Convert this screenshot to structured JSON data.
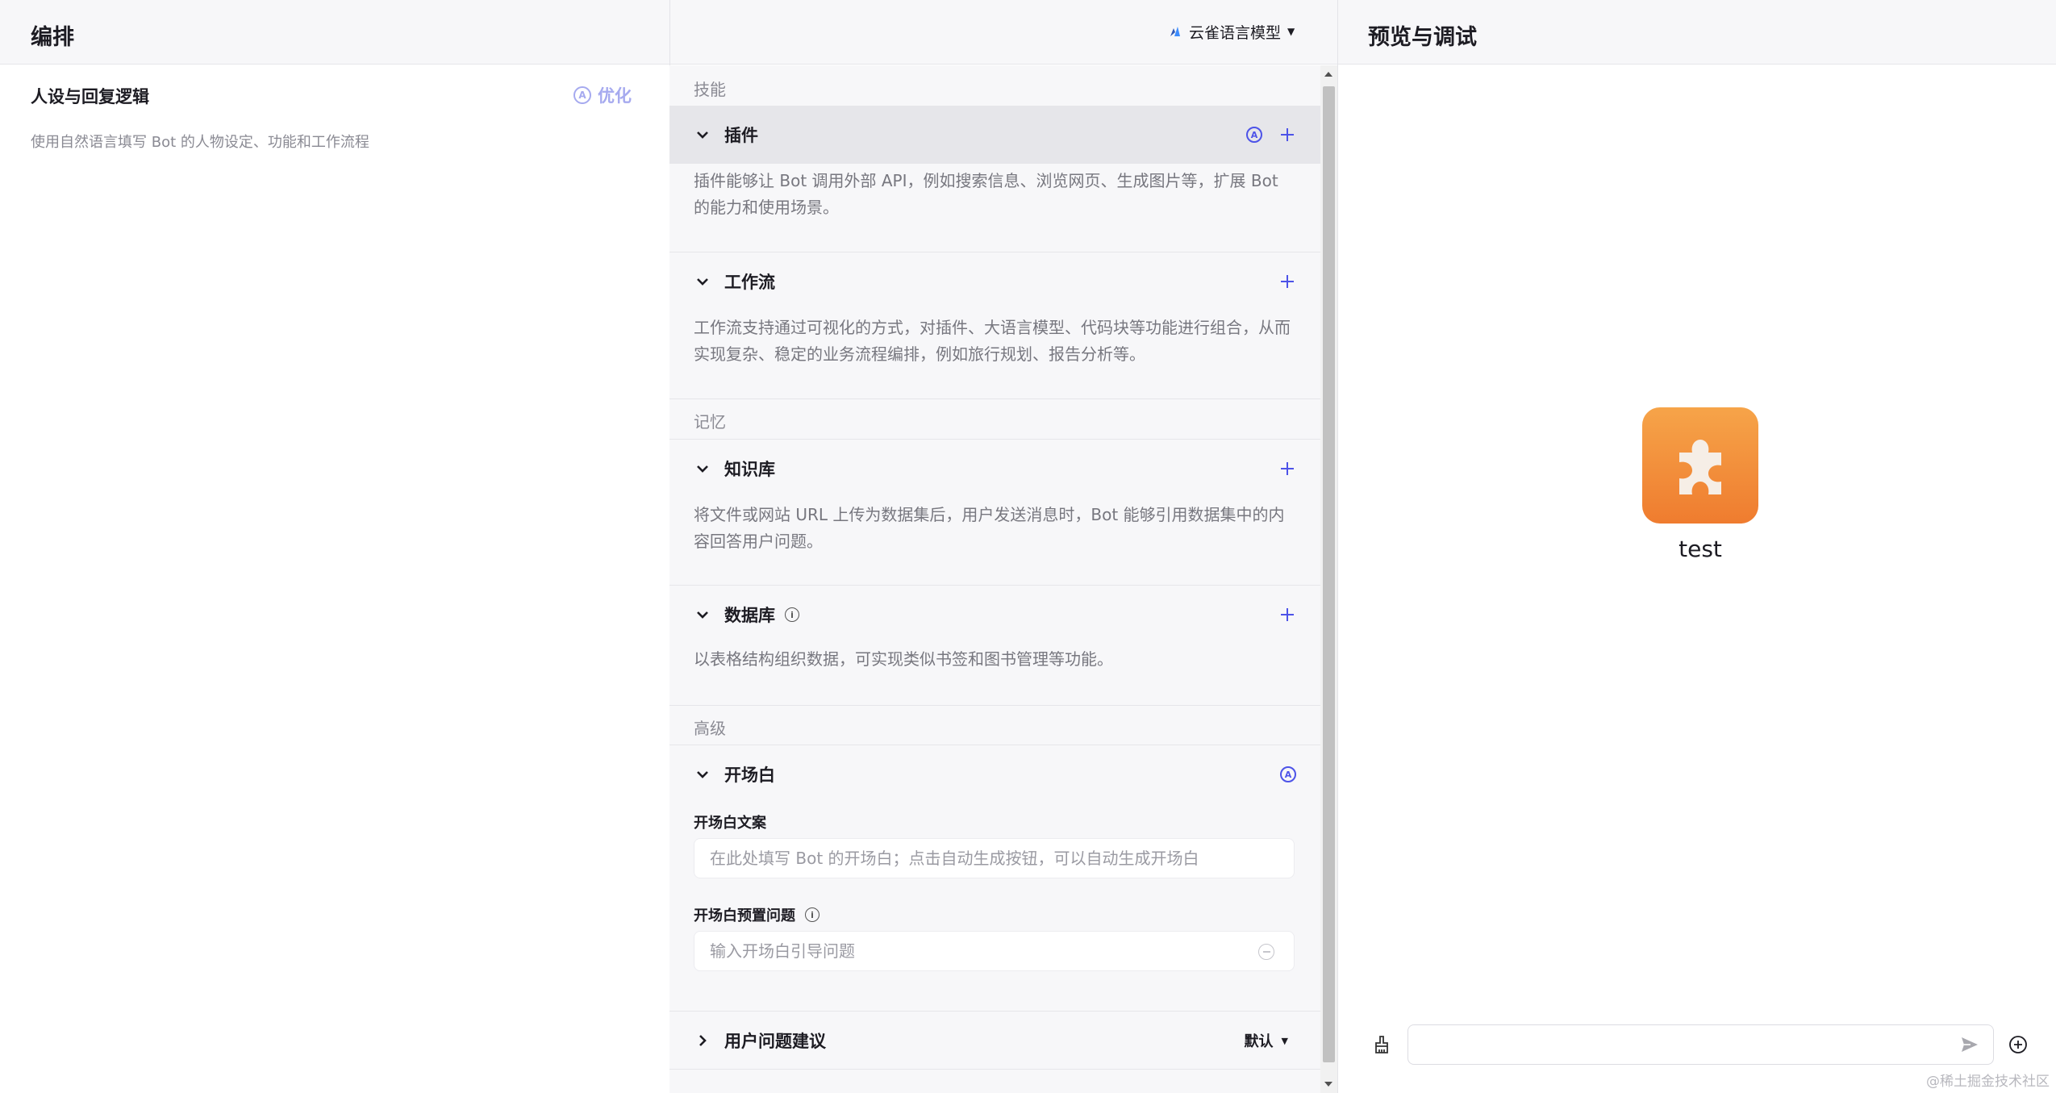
{
  "left_header": {
    "title": "编排",
    "model_name": "云雀语言模型"
  },
  "right_header": {
    "title": "预览与调试"
  },
  "persona": {
    "title": "人设与回复逻辑",
    "description": "使用自然语言填写 Bot 的人物设定、功能和工作流程",
    "optimize_label": "优化"
  },
  "skills": {
    "section_label": "技能",
    "plugin": {
      "title": "插件",
      "description": "插件能够让 Bot 调用外部 API，例如搜索信息、浏览网页、生成图片等，扩展 Bot 的能力和使用场景。"
    },
    "workflow": {
      "title": "工作流",
      "description": "工作流支持通过可视化的方式，对插件、大语言模型、代码块等功能进行组合，从而实现复杂、稳定的业务流程编排，例如旅行规划、报告分析等。"
    }
  },
  "memory": {
    "section_label": "记忆",
    "knowledge": {
      "title": "知识库",
      "description": "将文件或网站 URL 上传为数据集后，用户发送消息时，Bot 能够引用数据集中的内容回答用户问题。"
    },
    "database": {
      "title": "数据库",
      "description": "以表格结构组织数据，可实现类似书签和图书管理等功能。"
    }
  },
  "advanced": {
    "section_label": "高级",
    "opening": {
      "title": "开场白",
      "copy_label": "开场白文案",
      "copy_placeholder": "在此处填写 Bot 的开场白；点击自动生成按钮，可以自动生成开场白",
      "preset_label": "开场白预置问题",
      "preset_placeholder": "输入开场白引导问题"
    },
    "suggestions": {
      "title": "用户问题建议",
      "mode": "默认"
    }
  },
  "preview": {
    "bot_name": "test",
    "chat_placeholder": ""
  },
  "watermark": "@稀土掘金技术社区",
  "colors": {
    "accent": "#4d53e8",
    "avatar_top": "#f6a449",
    "avatar_bottom": "#ef7c2f"
  }
}
